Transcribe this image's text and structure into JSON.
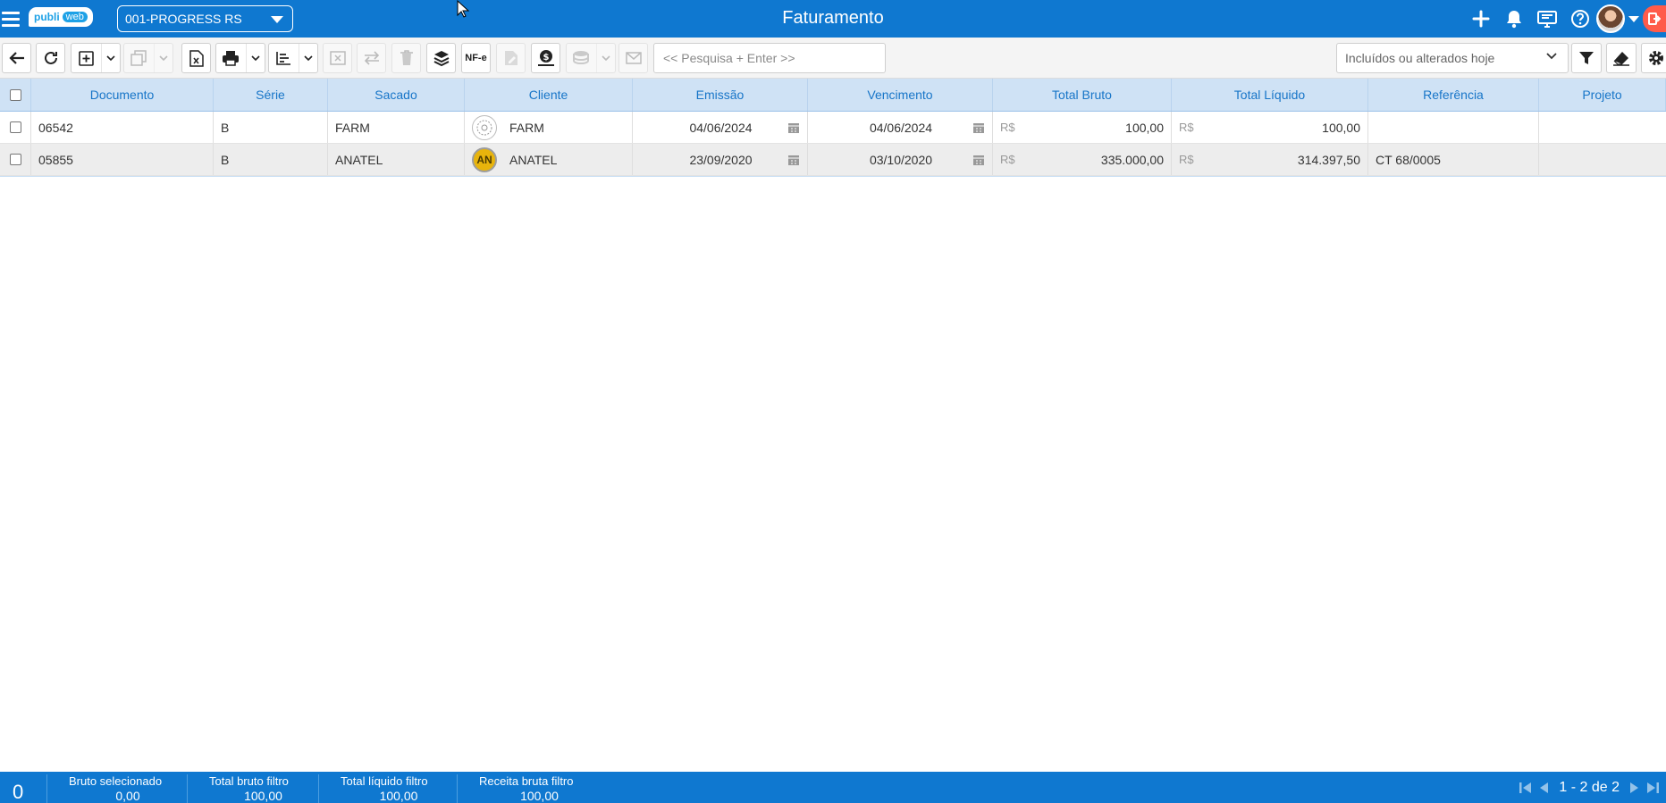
{
  "header": {
    "logo_left": "publi",
    "logo_right": "web",
    "company": "001-PROGRESS RS",
    "title": "Faturamento"
  },
  "toolbar": {
    "nfe_label": "NF-e",
    "search_placeholder": "<< Pesquisa + Enter >>",
    "filter_value": "Incluídos ou alterados hoje"
  },
  "grid": {
    "columns": [
      "Documento",
      "Série",
      "Sacado",
      "Cliente",
      "Emissão",
      "Vencimento",
      "Total Bruto",
      "Total Líquido",
      "Referência",
      "Projeto"
    ],
    "currency_symbol": "R$",
    "rows": [
      {
        "documento": "06542",
        "serie": "B",
        "sacado": "FARM",
        "cliente": "FARM",
        "cliente_initials": "",
        "emissao": "04/06/2024",
        "vencimento": "04/06/2024",
        "total_bruto": "100,00",
        "total_liquido": "100,00",
        "referencia": "",
        "projeto": ""
      },
      {
        "documento": "05855",
        "serie": "B",
        "sacado": "ANATEL",
        "cliente": "ANATEL",
        "cliente_initials": "AN",
        "emissao": "23/09/2020",
        "vencimento": "03/10/2020",
        "total_bruto": "335.000,00",
        "total_liquido": "314.397,50",
        "referencia": "CT 68/0005",
        "projeto": ""
      }
    ]
  },
  "footer": {
    "selected_count": "0",
    "bruto_selecionado_label": "Bruto selecionado",
    "bruto_selecionado_value": "0,00",
    "total_bruto_filtro_label": "Total bruto filtro",
    "total_bruto_filtro_value": "100,00",
    "total_liquido_filtro_label": "Total líquido filtro",
    "total_liquido_filtro_value": "100,00",
    "receita_bruta_filtro_label": "Receita bruta filtro",
    "receita_bruta_filtro_value": "100,00",
    "pagination": "1 - 2 de 2"
  },
  "colors": {
    "primary": "#0f78d0",
    "header_row": "#cfe2f5",
    "header_text": "#1775c8",
    "exit": "#ff5b4a",
    "client_an": "#e8b40c"
  }
}
